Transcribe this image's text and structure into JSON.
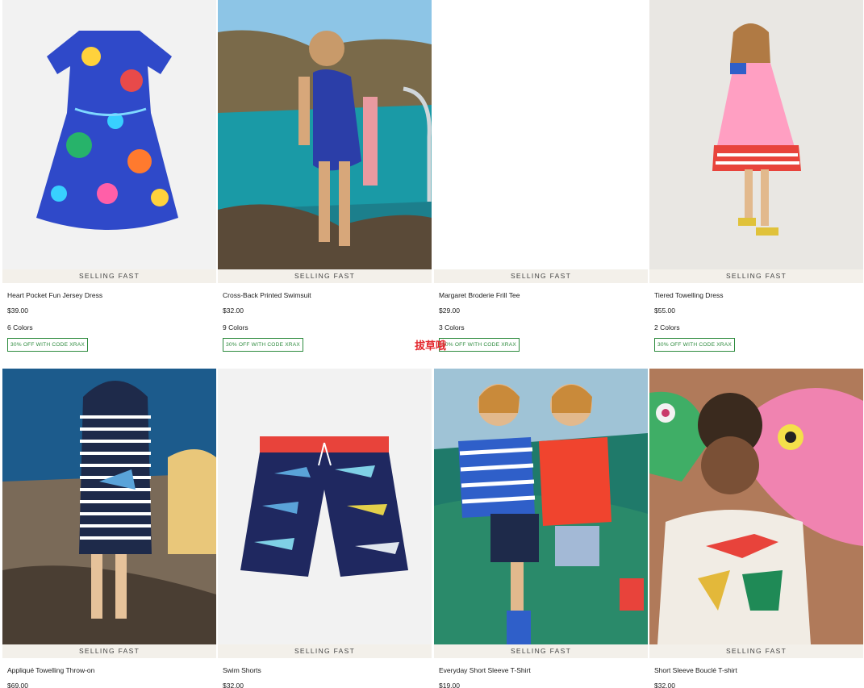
{
  "products": [
    {
      "badge": "SELLING FAST",
      "name": "Heart Pocket Fun Jersey Dress",
      "price": "$39.00",
      "colors": "6 Colors",
      "promo": "30% OFF WITH CODE XRAX",
      "image": "dress-with-sea-creature-print"
    },
    {
      "badge": "SELLING FAST",
      "name": "Cross-Back Printed Swimsuit",
      "price": "$32.00",
      "colors": "9 Colors",
      "promo": "30% OFF WITH CODE XRAX",
      "image": "girl-in-swimsuit-by-sea"
    },
    {
      "badge": "SELLING FAST",
      "name": "Margaret Broderie Frill Tee",
      "price": "$29.00",
      "colors": "3 Colors",
      "promo": "30% OFF WITH CODE XRAX",
      "image": "blank"
    },
    {
      "badge": "SELLING FAST",
      "name": "Tiered Towelling Dress",
      "price": "$55.00",
      "colors": "2 Colors",
      "promo": "30% OFF WITH CODE XRAX",
      "image": "girl-in-striped-dress"
    },
    {
      "badge": "SELLING FAST",
      "name": "Appliqué Towelling Throw-on",
      "price": "$69.00",
      "image": "boy-in-striped-hooded-throw-on"
    },
    {
      "badge": "SELLING FAST",
      "name": "Swim Shorts",
      "price": "$32.00",
      "image": "shark-print-swim-shorts"
    },
    {
      "badge": "SELLING FAST",
      "name": "Everyday Short Sleeve T-Shirt",
      "price": "$19.00",
      "image": "two-boys-on-fishing-nets"
    },
    {
      "badge": "SELLING FAST",
      "name": "Short Sleeve Bouclé T-shirt",
      "price": "$32.00",
      "image": "child-with-fish-props"
    }
  ],
  "overlay_text": "拔草哦",
  "colors": {
    "promo_green": "#2e8b3e",
    "badge_bg": "#f3f0ea",
    "overlay_red": "#e3272d"
  }
}
